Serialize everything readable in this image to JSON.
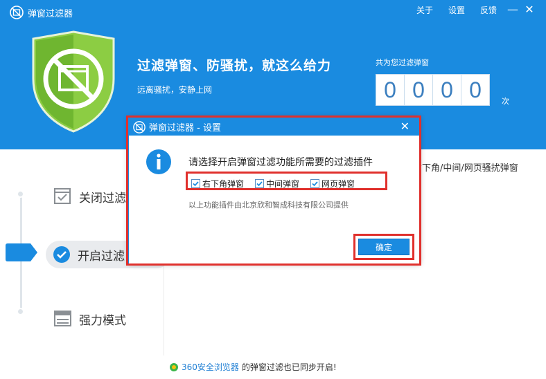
{
  "window": {
    "title": "弹窗过滤器",
    "menu": {
      "about": "关于",
      "settings": "设置",
      "feedback": "反馈"
    },
    "minimize": "—",
    "close": "✕"
  },
  "hero": {
    "headline": "过滤弹窗、防骚扰，就这么给力",
    "subline": "远离骚扰，安静上网",
    "count_label": "共为您过滤弹窗",
    "digits": [
      "0",
      "0",
      "0",
      "0"
    ],
    "count_unit": "次"
  },
  "sidebar": {
    "items": [
      {
        "label": "关闭过滤"
      },
      {
        "label": "开启过滤"
      },
      {
        "label": "强力模式"
      }
    ]
  },
  "panel": {
    "text": "右下角/中间/网页骚扰弹窗"
  },
  "footer": {
    "link": "360安全浏览器",
    "text": "的弹窗过滤也已同步开启!"
  },
  "dialog": {
    "title": "弹窗过滤器 - 设置",
    "close": "✕",
    "question": "请选择开启弹窗过滤功能所需要的过滤插件",
    "options": [
      {
        "label": "右下角弹窗",
        "checked": true
      },
      {
        "label": "中间弹窗",
        "checked": true
      },
      {
        "label": "网页弹窗",
        "checked": true
      }
    ],
    "note": "以上功能插件由北京欣和智成科技有限公司提供",
    "ok": "确定"
  },
  "colors": {
    "primary": "#1a8be0",
    "shield": "#7cc43a",
    "highlight": "#e0302c"
  }
}
